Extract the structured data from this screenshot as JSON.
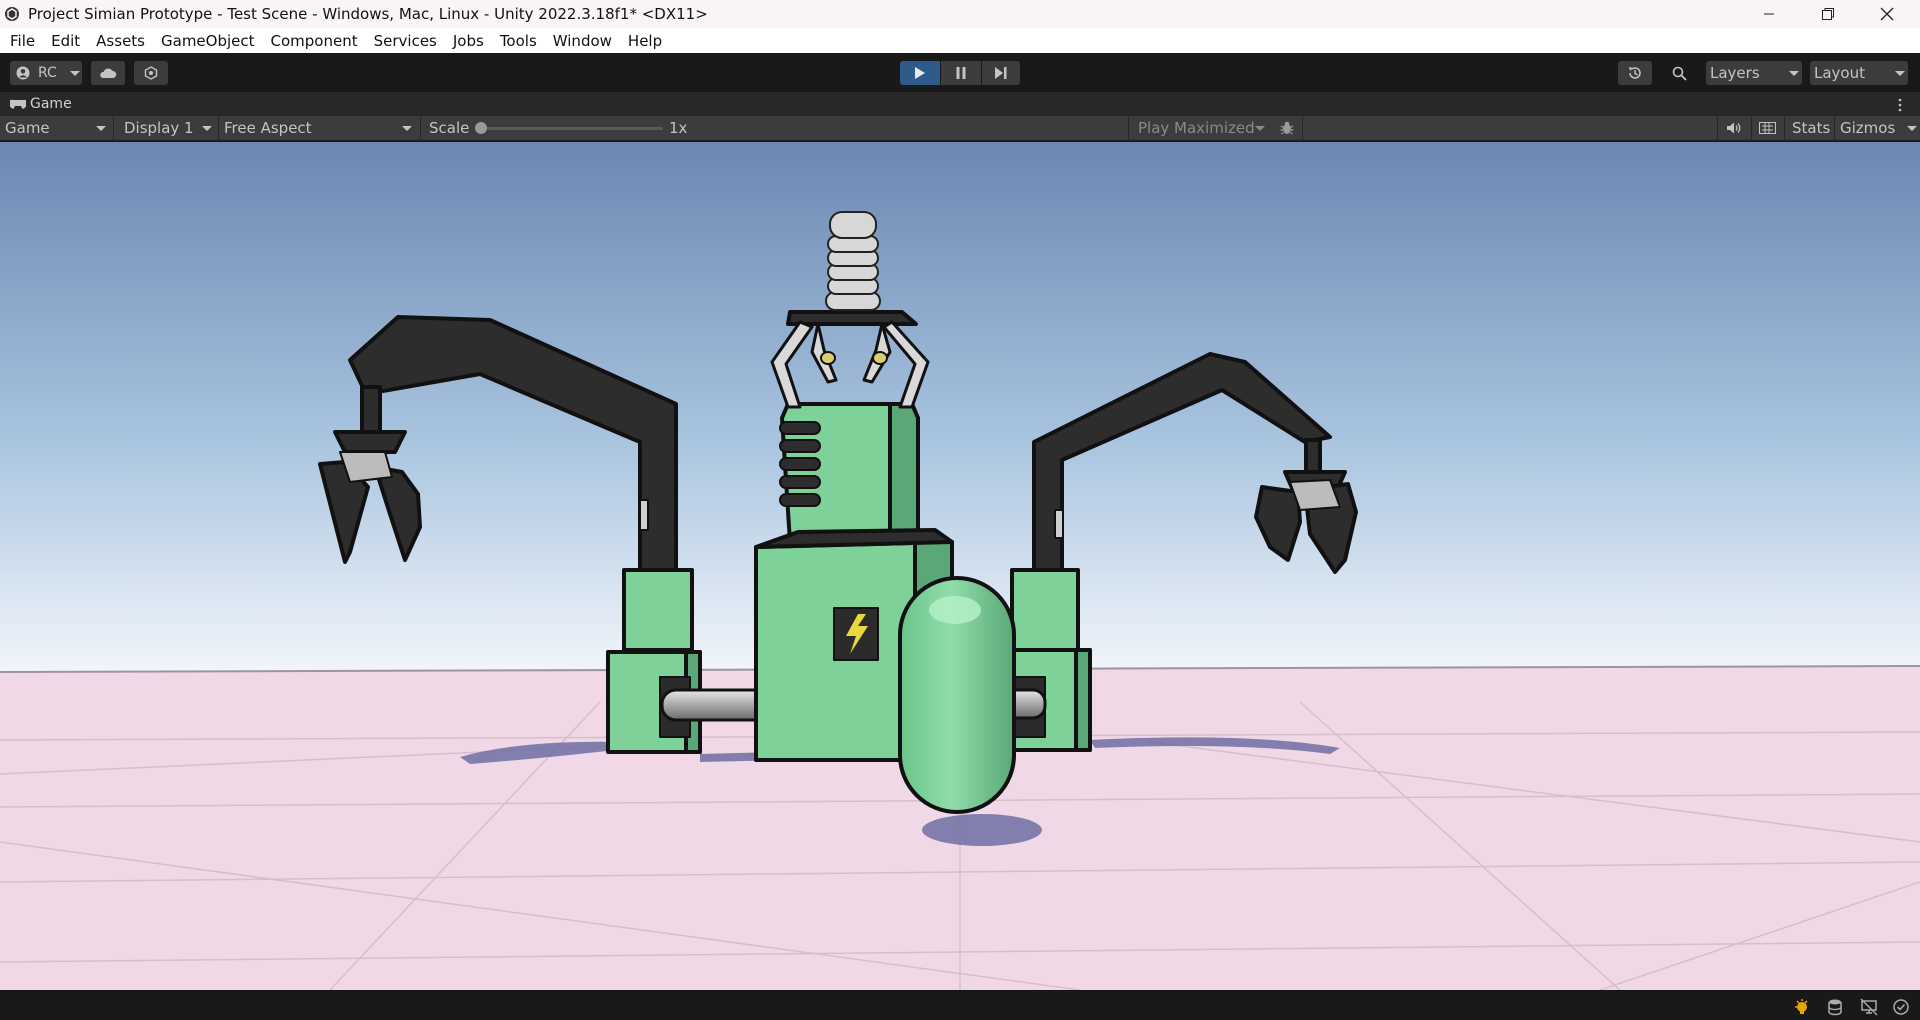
{
  "window": {
    "title": "Project Simian Prototype - Test Scene - Windows, Mac, Linux - Unity 2022.3.18f1* <DX11>"
  },
  "menu": [
    "File",
    "Edit",
    "Assets",
    "GameObject",
    "Component",
    "Services",
    "Jobs",
    "Tools",
    "Window",
    "Help"
  ],
  "toolbar": {
    "account_label": "RC",
    "layers_label": "Layers",
    "layout_label": "Layout",
    "play_active": true
  },
  "game_tab": {
    "label": "Game"
  },
  "game_toolbar": {
    "view_mode": "Game",
    "display": "Display 1",
    "aspect": "Free Aspect",
    "scale_label": "Scale",
    "scale_value": "1x",
    "play_mode": "Play Maximized",
    "stats_label": "Stats",
    "gizmos_label": "Gizmos"
  },
  "colors": {
    "accent_play": "#2f5b8a",
    "robot_green": "#7fd19a",
    "ground": "#f1d8e6"
  }
}
